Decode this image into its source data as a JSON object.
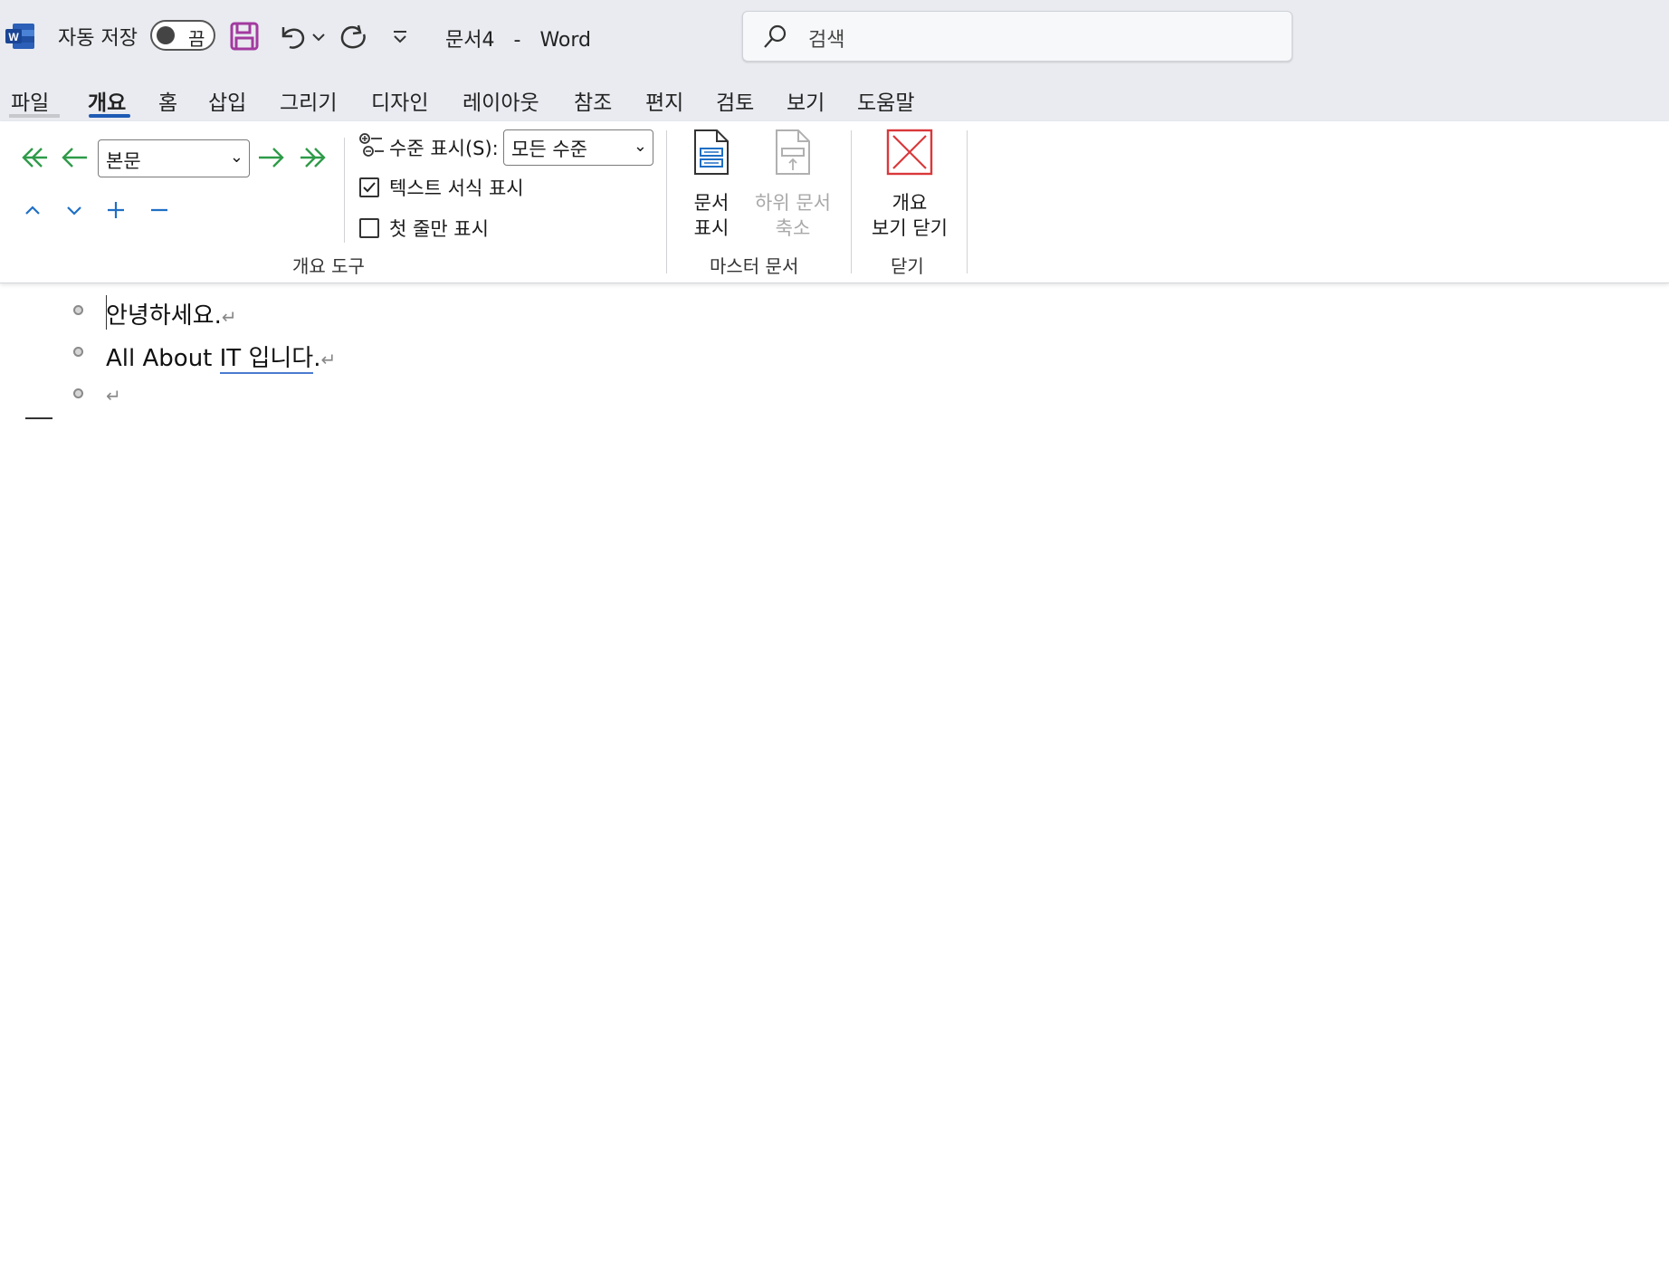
{
  "titlebar": {
    "autosave_label": "자동 저장",
    "autosave_state": "끔",
    "doc_name": "문서4",
    "separator": "-",
    "app_name": "Word",
    "search_placeholder": "검색"
  },
  "menu": {
    "tabs": [
      "파일",
      "개요",
      "홈",
      "삽입",
      "그리기",
      "디자인",
      "레이아웃",
      "참조",
      "편지",
      "검토",
      "보기",
      "도움말"
    ],
    "active_tab": "개요"
  },
  "ribbon": {
    "outline_tools": {
      "level_value": "본문",
      "show_level_label": "수준 표시(S):",
      "show_level_value": "모든 수준",
      "show_text_formatting_label": "텍스트 서식 표시",
      "show_text_formatting_checked": true,
      "show_first_line_only_label": "첫 줄만 표시",
      "show_first_line_only_checked": false,
      "group_label": "개요 도구"
    },
    "master_document": {
      "show_document_line1": "문서",
      "show_document_line2": "표시",
      "collapse_subdocs_line1": "하위 문서",
      "collapse_subdocs_line2": "축소",
      "group_label": "마스터 문서"
    },
    "close": {
      "close_outline_line1": "개요",
      "close_outline_line2": "보기 닫기",
      "group_label": "닫기"
    }
  },
  "document": {
    "line1": "안녕하세요.",
    "line2_plain": "All About ",
    "line2_flagged": "IT  입니다",
    "line2_end": ".",
    "pilcrow": "↵"
  },
  "colors": {
    "accent": "#1e5bb4",
    "arrow_green": "#2e9b49",
    "arrow_blue": "#1f6fc5",
    "close_red": "#d9383a",
    "save_purple": "#a23a9f"
  }
}
